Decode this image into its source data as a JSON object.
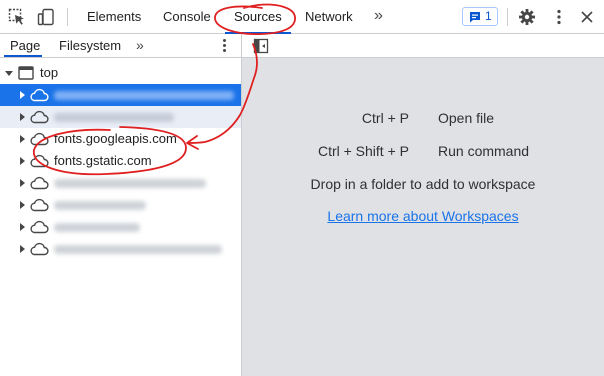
{
  "toolbar": {
    "tabs": [
      {
        "label": "Elements"
      },
      {
        "label": "Console"
      },
      {
        "label": "Sources",
        "active": true
      },
      {
        "label": "Network"
      }
    ],
    "more_tabs_glyph": "»",
    "issues_count": "1",
    "icons": [
      "inspect-element-icon",
      "device-toolbar-icon",
      "issues-icon",
      "settings-gear-icon",
      "more-options-icon"
    ]
  },
  "navigator": {
    "tabs": [
      {
        "label": "Page",
        "active": true
      },
      {
        "label": "Filesystem"
      }
    ],
    "more_tabs_glyph": "»",
    "tree": {
      "root_label": "top",
      "items": [
        {
          "label": "",
          "blurred": true,
          "selected": true
        },
        {
          "label": "",
          "blurred": true
        },
        {
          "label": "fonts.googleapis.com"
        },
        {
          "label": "fonts.gstatic.com"
        },
        {
          "label": "",
          "blurred": true
        },
        {
          "label": "",
          "blurred": true
        },
        {
          "label": "",
          "blurred": true
        },
        {
          "label": "",
          "blurred": true
        }
      ]
    }
  },
  "editor": {
    "shortcuts": [
      {
        "keys": "Ctrl + P",
        "description": "Open file"
      },
      {
        "keys": "Ctrl + Shift + P",
        "description": "Run command"
      }
    ],
    "drop_text": "Drop in a folder to add to workspace",
    "learn_more_link": "Learn more about Workspaces"
  },
  "colors": {
    "accent": "#1a73e8",
    "tab_underline": "#0b57d0",
    "editor_background": "#dfe1e5",
    "annotation": "#e02020"
  }
}
